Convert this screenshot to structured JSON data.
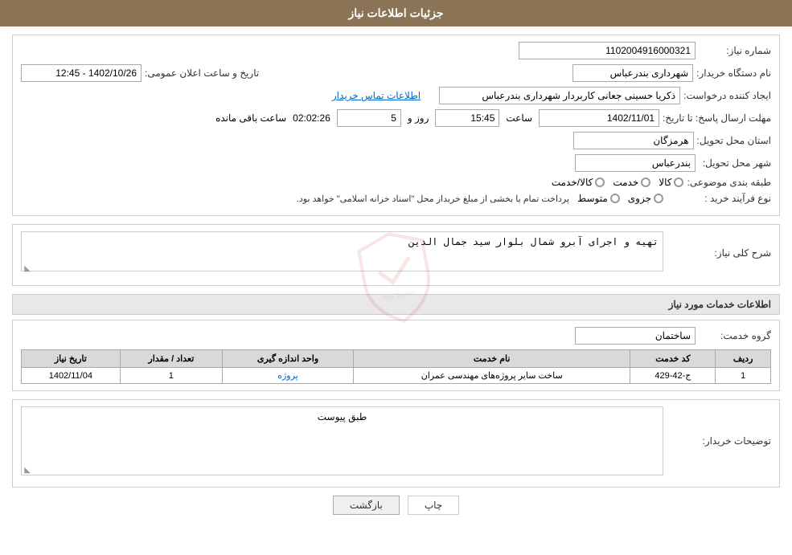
{
  "header": {
    "title": "جزئیات اطلاعات نیاز"
  },
  "labels": {
    "need_number": "شماره نیاز:",
    "buyer_org": "نام دستگاه خریدار:",
    "requester": "ایجاد کننده درخواست:",
    "response_deadline": "مهلت ارسال پاسخ: تا تاریخ:",
    "province": "استان محل تحویل:",
    "city": "شهر محل تحویل:",
    "category": "طبقه بندی موضوعی:",
    "process_type": "نوع فرآیند خرید :",
    "description_label": "شرح کلی نیاز:",
    "services_title": "اطلاعات خدمات مورد نیاز",
    "service_group": "گروه خدمت:",
    "table_col_row": "ردیف",
    "table_col_code": "کد خدمت",
    "table_col_name": "نام خدمت",
    "table_col_unit": "واحد اندازه گیری",
    "table_col_quantity": "تعداد / مقدار",
    "table_col_date": "تاریخ نیاز",
    "buyer_notes": "توضیحات خریدار:",
    "announce_date": "تاریخ و ساعت اعلان عمومی:"
  },
  "values": {
    "need_number": "1102004916000321",
    "buyer_org": "شهرداری بندرعباس",
    "requester": "ذکریا حسینی جعانی کاربردار شهرداری بندرعباس",
    "contact_link": "اطلاعات تماس خریدار",
    "announce_date": "1402/10/26 - 12:45",
    "response_date": "1402/11/01",
    "response_time": "15:45",
    "response_days": "5",
    "response_remaining": "02:02:26",
    "province": "هرمزگان",
    "city": "بندرعباس",
    "category_kala": "کالا",
    "category_service": "خدمت",
    "category_kala_service": "کالا/خدمت",
    "process_jozvi": "جزوی",
    "process_motevaset": "متوسط",
    "process_description": "پرداخت تمام یا بخشی از مبلغ خریداز محل \"اسناد خزانه اسلامی\" خواهد بود.",
    "description_text": "تهیه و اجرای آبرو شمال بلوار سید جمال الدین",
    "service_group_value": "ساختمان",
    "table_rows": [
      {
        "row": "1",
        "code": "ج-42-429",
        "name": "ساخت سایر پروژه‌های مهندسی عمران",
        "unit": "پروژه",
        "quantity": "1",
        "date": "1402/11/04"
      }
    ],
    "buyer_notes_text": "طبق پیوست",
    "days_label": "روز و",
    "remaining_label": "ساعت باقی مانده",
    "time_label": "ساعت"
  },
  "buttons": {
    "back": "بازگشت",
    "print": "چاپ"
  }
}
